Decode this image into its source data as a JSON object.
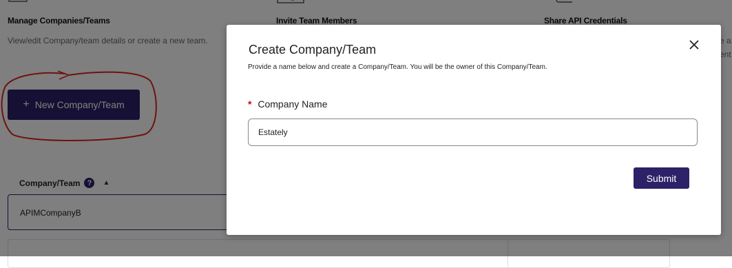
{
  "features": [
    {
      "icon": "building-gear-icon",
      "title": "Manage Companies/Teams",
      "desc": "View/edit Company/team details or create a new team."
    },
    {
      "icon": "monitor-gear-icon",
      "title": "Invite Team Members",
      "desc": ""
    },
    {
      "icon": "document-icon",
      "title": "Share API Credentials",
      "desc": ""
    }
  ],
  "partial_right_text": [
    "e a",
    "ent"
  ],
  "new_team_button": {
    "plus": "+",
    "label": "New Company/Team"
  },
  "table": {
    "header": "Company/Team",
    "rows": [
      "APIMCompanyB"
    ]
  },
  "modal": {
    "title": "Create Company/Team",
    "subtitle": "Provide a name below and create a Company/Team. You will be the owner of this Company/Team.",
    "required_mark": "*",
    "field_label": "Company Name",
    "field_value": "Estately",
    "submit_label": "Submit"
  },
  "colors": {
    "primary": "#2d2168",
    "required": "#d0021b",
    "annotation": "#e02020"
  }
}
